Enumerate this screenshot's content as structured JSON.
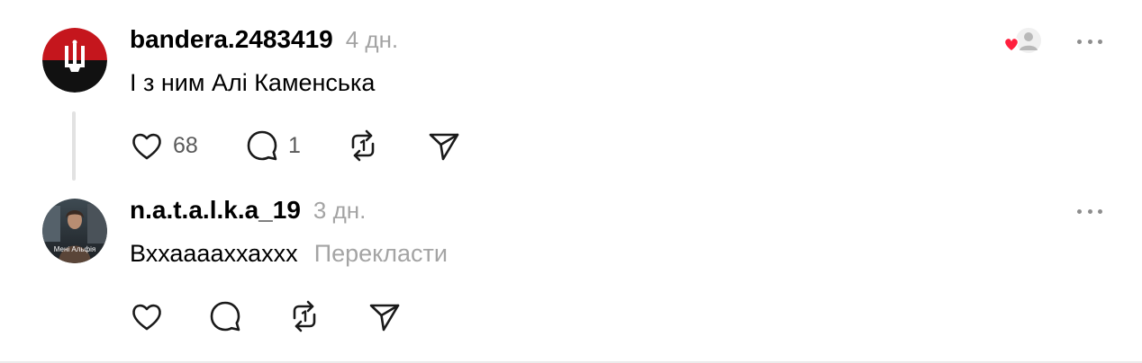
{
  "comments": [
    {
      "username": "bandera.2483419",
      "time": "4 дн.",
      "text": "І з ним Алі Каменська",
      "like_count": "68",
      "reply_count": "1",
      "avatar_colors": [
        "#c5161d",
        "#111111"
      ],
      "icons": [
        "heart-icon",
        "reply-icon",
        "repost-icon",
        "share-icon",
        "more-icon"
      ]
    },
    {
      "username": "n.a.t.a.l.k.a_19",
      "time": "3 дн.",
      "text": "Вххааааххаххх",
      "translate_label": "Перекласти",
      "avatar_text": "Мені Альфія",
      "icons": [
        "heart-icon",
        "reply-icon",
        "repost-icon",
        "share-icon",
        "more-icon"
      ]
    }
  ],
  "colors": {
    "secondary_text": "#a4a4a4",
    "like_red": "#ff1f3d",
    "icon_stroke": "#1a1a1a"
  }
}
